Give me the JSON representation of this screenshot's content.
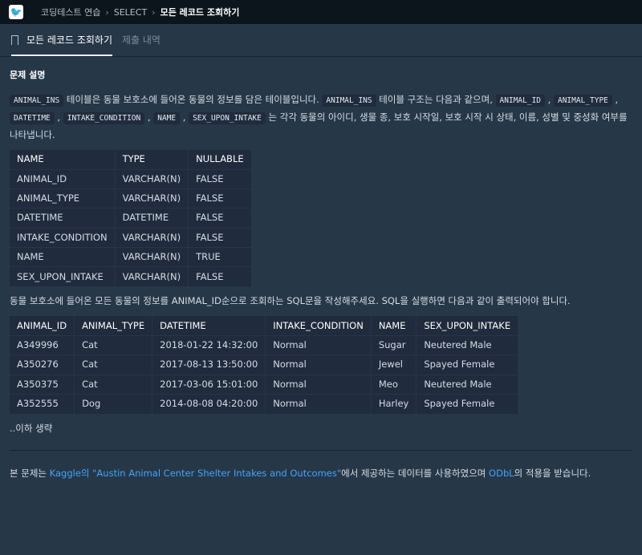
{
  "breadcrumb": {
    "items": [
      "코딩테스트 연습",
      "SELECT"
    ],
    "current": "모든 레코드 조회하기"
  },
  "tabs": {
    "active": "모든 레코드 조회하기",
    "submissions": "제출 내역"
  },
  "section_title": "문제 설명",
  "desc": {
    "c1": "ANIMAL_INS",
    "t1": " 테이블은 동물 보호소에 들어온 동물의 정보를 담은 테이블입니다. ",
    "c2": "ANIMAL_INS",
    "t2": " 테이블 구조는 다음과 같으며, ",
    "c3": "ANIMAL_ID",
    "c4": "ANIMAL_TYPE",
    "c5": "DATETIME",
    "c6": "INTAKE_CONDITION",
    "c7": "NAME",
    "c8": "SEX_UPON_INTAKE",
    "t3": " 는 각각 동물의 아이디, 생물 종, 보호 시작일, 보호 시작 시 상태, 이름, 성별 및 중성화 여부를 나타냅니다."
  },
  "schema": {
    "headers": [
      "NAME",
      "TYPE",
      "NULLABLE"
    ],
    "rows": [
      [
        "ANIMAL_ID",
        "VARCHAR(N)",
        "FALSE"
      ],
      [
        "ANIMAL_TYPE",
        "VARCHAR(N)",
        "FALSE"
      ],
      [
        "DATETIME",
        "DATETIME",
        "FALSE"
      ],
      [
        "INTAKE_CONDITION",
        "VARCHAR(N)",
        "FALSE"
      ],
      [
        "NAME",
        "VARCHAR(N)",
        "TRUE"
      ],
      [
        "SEX_UPON_INTAKE",
        "VARCHAR(N)",
        "FALSE"
      ]
    ]
  },
  "task": "동물 보호소에 들어온 모든 동물의 정보를 ANIMAL_ID순으로 조회하는 SQL문을 작성해주세요. SQL을 실행하면 다음과 같이 출력되어야 합니다.",
  "result": {
    "headers": [
      "ANIMAL_ID",
      "ANIMAL_TYPE",
      "DATETIME",
      "INTAKE_CONDITION",
      "NAME",
      "SEX_UPON_INTAKE"
    ],
    "rows": [
      [
        "A349996",
        "Cat",
        "2018-01-22 14:32:00",
        "Normal",
        "Sugar",
        "Neutered Male"
      ],
      [
        "A350276",
        "Cat",
        "2017-08-13 13:50:00",
        "Normal",
        "Jewel",
        "Spayed Female"
      ],
      [
        "A350375",
        "Cat",
        "2017-03-06 15:01:00",
        "Normal",
        "Meo",
        "Neutered Male"
      ],
      [
        "A352555",
        "Dog",
        "2014-08-08 04:20:00",
        "Normal",
        "Harley",
        "Spayed Female"
      ]
    ]
  },
  "omitted": "..이하 생략",
  "footer": {
    "p1": "본 문제는 ",
    "link1": "Kaggle의 \"Austin Animal Center Shelter Intakes and Outcomes\"",
    "p2": "에서 제공하는 데이터를 사용하였으며 ",
    "link2": "ODbL",
    "p3": "의 적용을 받습니다."
  }
}
